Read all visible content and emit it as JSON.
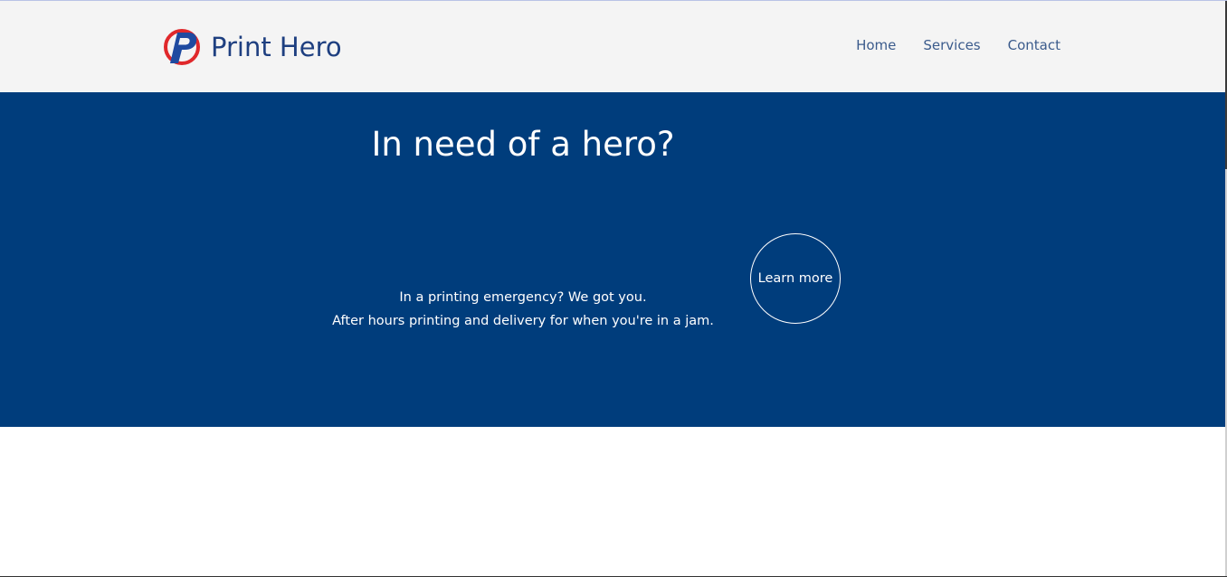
{
  "header": {
    "brand_name": "Print Hero",
    "logo_icon": "print-hero-p-logo-icon",
    "nav": [
      {
        "label": "Home"
      },
      {
        "label": "Services"
      },
      {
        "label": "Contact"
      }
    ]
  },
  "hero": {
    "title": "In need of a hero?",
    "line1": "In a printing emergency? We got you.",
    "line2": "After hours printing and delivery for when you're in a jam.",
    "button_label": "Learn more"
  },
  "colors": {
    "header_bg": "#f4f4f4",
    "brand": "#1e3f80",
    "nav_text": "#3b5b8c",
    "hero_bg": "#003d7c",
    "logo_red": "#e0282b",
    "logo_blue": "#1f4aa0"
  }
}
